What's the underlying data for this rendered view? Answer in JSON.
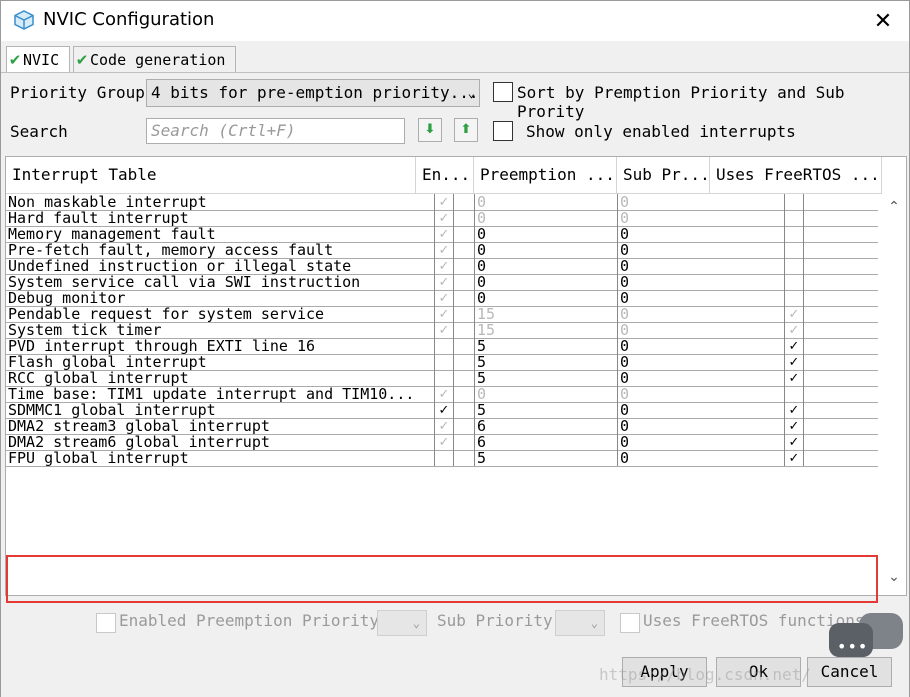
{
  "window": {
    "title": "NVIC Configuration",
    "close_glyph": "✕"
  },
  "tabs": [
    {
      "label": "NVIC",
      "check": "✔"
    },
    {
      "label": "Code generation",
      "check": "✔"
    }
  ],
  "controls": {
    "priority_group_label": "Priority Group",
    "priority_group_value": "4 bits for pre-emption priority...",
    "sort_label": "Sort by Premption Priority and Sub Prority",
    "search_label": "Search",
    "search_placeholder": "Search (Crtl+F)",
    "show_enabled_label": "Show only enabled interrupts",
    "down_arrow": "⬇",
    "up_arrow": "⬆"
  },
  "table": {
    "headers": [
      "Interrupt Table",
      "En...",
      "Preemption ...",
      "Sub Pr...",
      "Uses FreeRTOS ..."
    ],
    "rows": [
      {
        "name": "Non maskable interrupt",
        "enabled": "✓",
        "en_gray": true,
        "pre": "0",
        "sub": "0",
        "vals_gray": true,
        "rtos": ""
      },
      {
        "name": "Hard fault interrupt",
        "enabled": "✓",
        "en_gray": true,
        "pre": "0",
        "sub": "0",
        "vals_gray": true,
        "rtos": ""
      },
      {
        "name": "Memory management fault",
        "enabled": "✓",
        "en_gray": true,
        "pre": "0",
        "sub": "0",
        "vals_gray": false,
        "rtos": ""
      },
      {
        "name": "Pre-fetch fault, memory access fault",
        "enabled": "✓",
        "en_gray": true,
        "pre": "0",
        "sub": "0",
        "vals_gray": false,
        "rtos": ""
      },
      {
        "name": "Undefined instruction or illegal state",
        "enabled": "✓",
        "en_gray": true,
        "pre": "0",
        "sub": "0",
        "vals_gray": false,
        "rtos": ""
      },
      {
        "name": "System service call via SWI instruction",
        "enabled": "✓",
        "en_gray": true,
        "pre": "0",
        "sub": "0",
        "vals_gray": false,
        "rtos": ""
      },
      {
        "name": "Debug monitor",
        "enabled": "✓",
        "en_gray": true,
        "pre": "0",
        "sub": "0",
        "vals_gray": false,
        "rtos": ""
      },
      {
        "name": "Pendable request for system service",
        "enabled": "✓",
        "en_gray": true,
        "pre": "15",
        "sub": "0",
        "vals_gray": true,
        "rtos": "✓",
        "rtos_gray": true
      },
      {
        "name": "System tick timer",
        "enabled": "✓",
        "en_gray": true,
        "pre": "15",
        "sub": "0",
        "vals_gray": true,
        "rtos": "✓",
        "rtos_gray": true
      },
      {
        "name": "PVD interrupt through EXTI line 16",
        "enabled": "",
        "en_gray": false,
        "pre": "5",
        "sub": "0",
        "vals_gray": false,
        "rtos": "✓",
        "rtos_gray": false
      },
      {
        "name": "Flash global interrupt",
        "enabled": "",
        "en_gray": false,
        "pre": "5",
        "sub": "0",
        "vals_gray": false,
        "rtos": "✓",
        "rtos_gray": false
      },
      {
        "name": "RCC global interrupt",
        "enabled": "",
        "en_gray": false,
        "pre": "5",
        "sub": "0",
        "vals_gray": false,
        "rtos": "✓",
        "rtos_gray": false
      },
      {
        "name": "Time base: TIM1 update interrupt and TIM10...",
        "enabled": "✓",
        "en_gray": true,
        "pre": "0",
        "sub": "0",
        "vals_gray": true,
        "rtos": ""
      },
      {
        "name": "SDMMC1 global interrupt",
        "enabled": "✓",
        "en_gray": false,
        "pre": "5",
        "sub": "0",
        "vals_gray": false,
        "rtos": "✓",
        "rtos_gray": false
      },
      {
        "name": "DMA2 stream3 global interrupt",
        "enabled": "✓",
        "en_gray": true,
        "pre": "6",
        "sub": "0",
        "vals_gray": false,
        "rtos": "✓",
        "rtos_gray": false
      },
      {
        "name": "DMA2 stream6 global interrupt",
        "enabled": "✓",
        "en_gray": true,
        "pre": "6",
        "sub": "0",
        "vals_gray": false,
        "rtos": "✓",
        "rtos_gray": false
      },
      {
        "name": "FPU global interrupt",
        "enabled": "",
        "en_gray": false,
        "pre": "5",
        "sub": "0",
        "vals_gray": false,
        "rtos": "✓",
        "rtos_gray": false
      }
    ],
    "scroll_up": "⌃",
    "scroll_down": "⌄"
  },
  "bottom": {
    "enabled_label": "Enabled",
    "preemption_label": "Preemption Priority",
    "sub_label": "Sub Priority",
    "uses_rtos_label": "Uses FreeRTOS functions",
    "combo_arrow": "⌄"
  },
  "buttons": {
    "apply": "Apply",
    "ok": "Ok",
    "cancel": "Cancel"
  },
  "overlay": {
    "chat_dots": "•••",
    "watermark": "https://blog.csdn.net/"
  },
  "colors": {
    "highlight": "#e53935",
    "check_green": "#2ea043"
  }
}
